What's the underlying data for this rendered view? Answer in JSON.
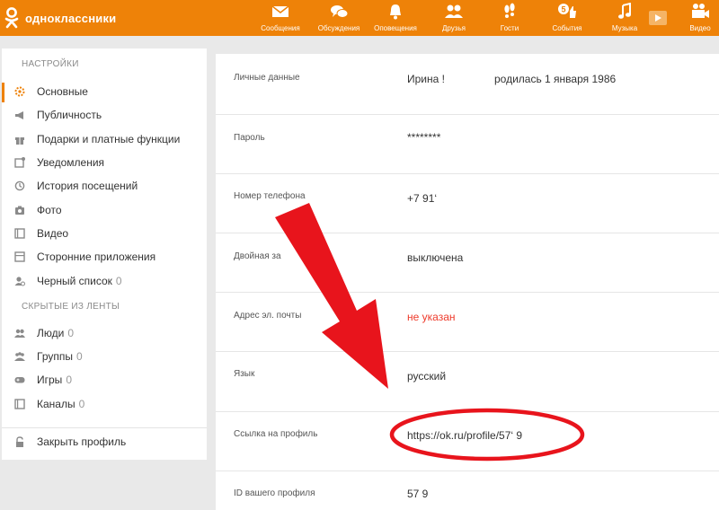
{
  "brand": {
    "name": "одноклассники"
  },
  "topnav": [
    {
      "label": "Сообщения",
      "icon": "envelope-icon"
    },
    {
      "label": "Обсуждения",
      "icon": "chat-bubbles-icon"
    },
    {
      "label": "Оповещения",
      "icon": "bell-icon"
    },
    {
      "label": "Друзья",
      "icon": "friends-icon"
    },
    {
      "label": "Гости",
      "icon": "footprints-icon"
    },
    {
      "label": "События",
      "icon": "thumbs-up-icon",
      "badge": "5"
    },
    {
      "label": "Музыка",
      "icon": "music-note-icon"
    },
    {
      "label": "Видео",
      "icon": "video-camera-icon"
    }
  ],
  "sidebar": {
    "settings_header": "НАСТРОЙКИ",
    "settings_items": [
      {
        "label": "Основные",
        "icon": "gear-icon",
        "active": true
      },
      {
        "label": "Публичность",
        "icon": "megaphone-icon"
      },
      {
        "label": "Подарки и платные функции",
        "icon": "gift-icon"
      },
      {
        "label": "Уведомления",
        "icon": "notification-icon"
      },
      {
        "label": "История посещений",
        "icon": "history-icon"
      },
      {
        "label": "Фото",
        "icon": "camera-icon"
      },
      {
        "label": "Видео",
        "icon": "film-icon"
      },
      {
        "label": "Сторонние приложения",
        "icon": "apps-icon"
      },
      {
        "label": "Черный список",
        "icon": "blocked-user-icon",
        "count": "0"
      }
    ],
    "hidden_header": "СКРЫТЫЕ ИЗ ЛЕНТЫ",
    "hidden_items": [
      {
        "label": "Люди",
        "icon": "people-icon",
        "count": "0"
      },
      {
        "label": "Группы",
        "icon": "groups-icon",
        "count": "0"
      },
      {
        "label": "Игры",
        "icon": "gamepad-icon",
        "count": "0"
      },
      {
        "label": "Каналы",
        "icon": "channels-icon",
        "count": "0"
      }
    ],
    "close_profile": {
      "label": "Закрыть профиль",
      "icon": "lock-icon"
    }
  },
  "profile_rows": [
    {
      "label": "Личные данные",
      "value": "Ирина !",
      "extra": "родилась 1 января 1986"
    },
    {
      "label": "Пароль",
      "value": "********"
    },
    {
      "label": "Номер телефона",
      "value": "+7 91‘"
    },
    {
      "label": "Двойная за",
      "value": "выключена"
    },
    {
      "label": "Адрес эл. почты",
      "value": "не указан",
      "status": "warning"
    },
    {
      "label": "Язык",
      "value": "русский"
    },
    {
      "label": "Ссылка на профиль",
      "value": "https://ok.ru/profile/57‘                 9"
    },
    {
      "label": "ID вашего профиля",
      "value": "57               9"
    }
  ],
  "colors": {
    "brand": "#ee8208",
    "warning": "#ee3a2b",
    "highlight": "#e8141c"
  }
}
